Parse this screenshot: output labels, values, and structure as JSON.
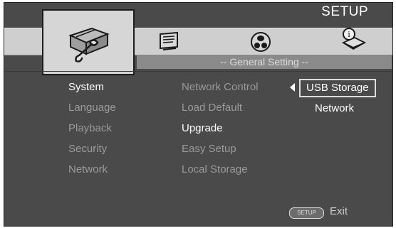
{
  "header": {
    "title": "SETUP",
    "section": "-- General Setting --"
  },
  "icons": [
    "toolbox-wrench-icon",
    "display-icon",
    "speaker-icon",
    "info-book-icon"
  ],
  "menu": {
    "items": [
      {
        "label": "System",
        "selected": true
      },
      {
        "label": "Language",
        "selected": false
      },
      {
        "label": "Playback",
        "selected": false
      },
      {
        "label": "Security",
        "selected": false
      },
      {
        "label": "Network",
        "selected": false
      }
    ]
  },
  "submenu": {
    "items": [
      {
        "label": "Network Control",
        "active": false
      },
      {
        "label": "Load Default",
        "active": false
      },
      {
        "label": "Upgrade",
        "active": true
      },
      {
        "label": "Easy Setup",
        "active": false
      },
      {
        "label": "Local Storage",
        "active": false
      }
    ]
  },
  "options": {
    "items": [
      {
        "label": "USB Storage",
        "highlighted": true
      },
      {
        "label": "Network",
        "highlighted": false
      }
    ]
  },
  "footer": {
    "button_label": "SETUP",
    "exit_label": "Exit"
  },
  "colors": {
    "background": "#4a4a4a",
    "strip": "#cfcfcf",
    "text_active": "#ffffff",
    "text_dim": "#9a9a9a"
  }
}
